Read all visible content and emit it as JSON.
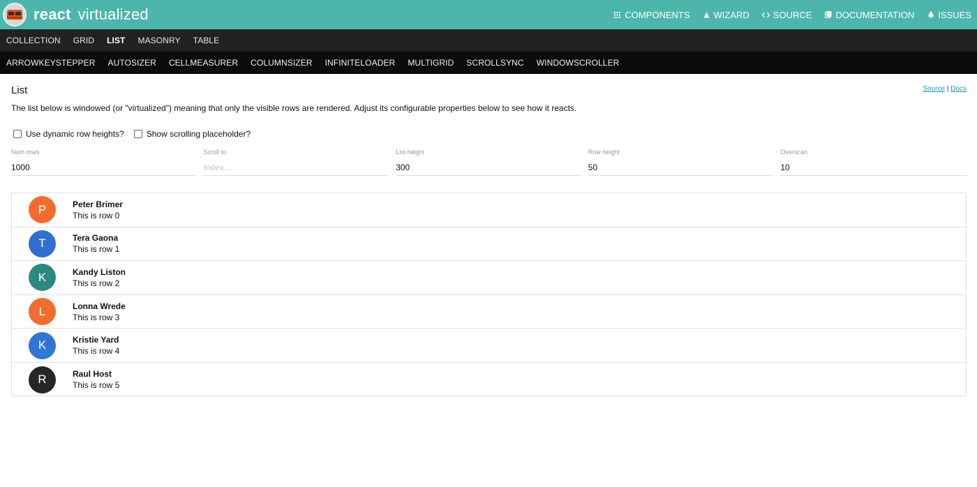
{
  "header": {
    "brand_react": "react",
    "brand_virtualized": "virtualized",
    "nav": [
      {
        "label": "COMPONENTS",
        "icon": "grid-icon"
      },
      {
        "label": "WIZARD",
        "icon": "triangle-icon"
      },
      {
        "label": "SOURCE",
        "icon": "code-icon"
      },
      {
        "label": "DOCUMENTATION",
        "icon": "book-icon"
      },
      {
        "label": "ISSUES",
        "icon": "bug-icon"
      }
    ]
  },
  "components_nav": [
    "COLLECTION",
    "GRID",
    "LIST",
    "MASONRY",
    "TABLE"
  ],
  "active_component": "LIST",
  "hoc_nav": [
    "ARROWKEYSTEPPER",
    "AUTOSIZER",
    "CELLMEASURER",
    "COLUMNSIZER",
    "INFINITELOADER",
    "MULTIGRID",
    "SCROLLSYNC",
    "WINDOWSCROLLER"
  ],
  "page": {
    "title": "List",
    "source_link": "Source",
    "separator": "|",
    "docs_link": "Docs",
    "description": "The list below is windowed (or \"virtualized\") meaning that only the visible rows are rendered. Adjust its configurable properties below to see how it reacts."
  },
  "options": {
    "dynamic_heights_label": "Use dynamic row heights?",
    "dynamic_heights_checked": false,
    "placeholder_label": "Show scrolling placeholder?",
    "placeholder_checked": false
  },
  "fields": {
    "num_rows": {
      "label": "Num rows",
      "value": "1000"
    },
    "scroll_to": {
      "label": "Scroll to",
      "placeholder": "Index..."
    },
    "list_height": {
      "label": "List height",
      "value": "300"
    },
    "row_height": {
      "label": "Row height",
      "value": "50"
    },
    "overscan": {
      "label": "Overscan",
      "value": "10"
    }
  },
  "rows": [
    {
      "initial": "P",
      "name": "Peter Brimer",
      "sub": "This is row 0",
      "color": "#f26d2b"
    },
    {
      "initial": "T",
      "name": "Tera Gaona",
      "sub": "This is row 1",
      "color": "#2f6fd0"
    },
    {
      "initial": "K",
      "name": "Kandy Liston",
      "sub": "This is row 2",
      "color": "#2a8a7e"
    },
    {
      "initial": "L",
      "name": "Lonna Wrede",
      "sub": "This is row 3",
      "color": "#f26d2b"
    },
    {
      "initial": "K",
      "name": "Kristie Yard",
      "sub": "This is row 4",
      "color": "#2f76d6"
    },
    {
      "initial": "R",
      "name": "Raul Host",
      "sub": "This is row 5",
      "color": "#262626"
    }
  ]
}
